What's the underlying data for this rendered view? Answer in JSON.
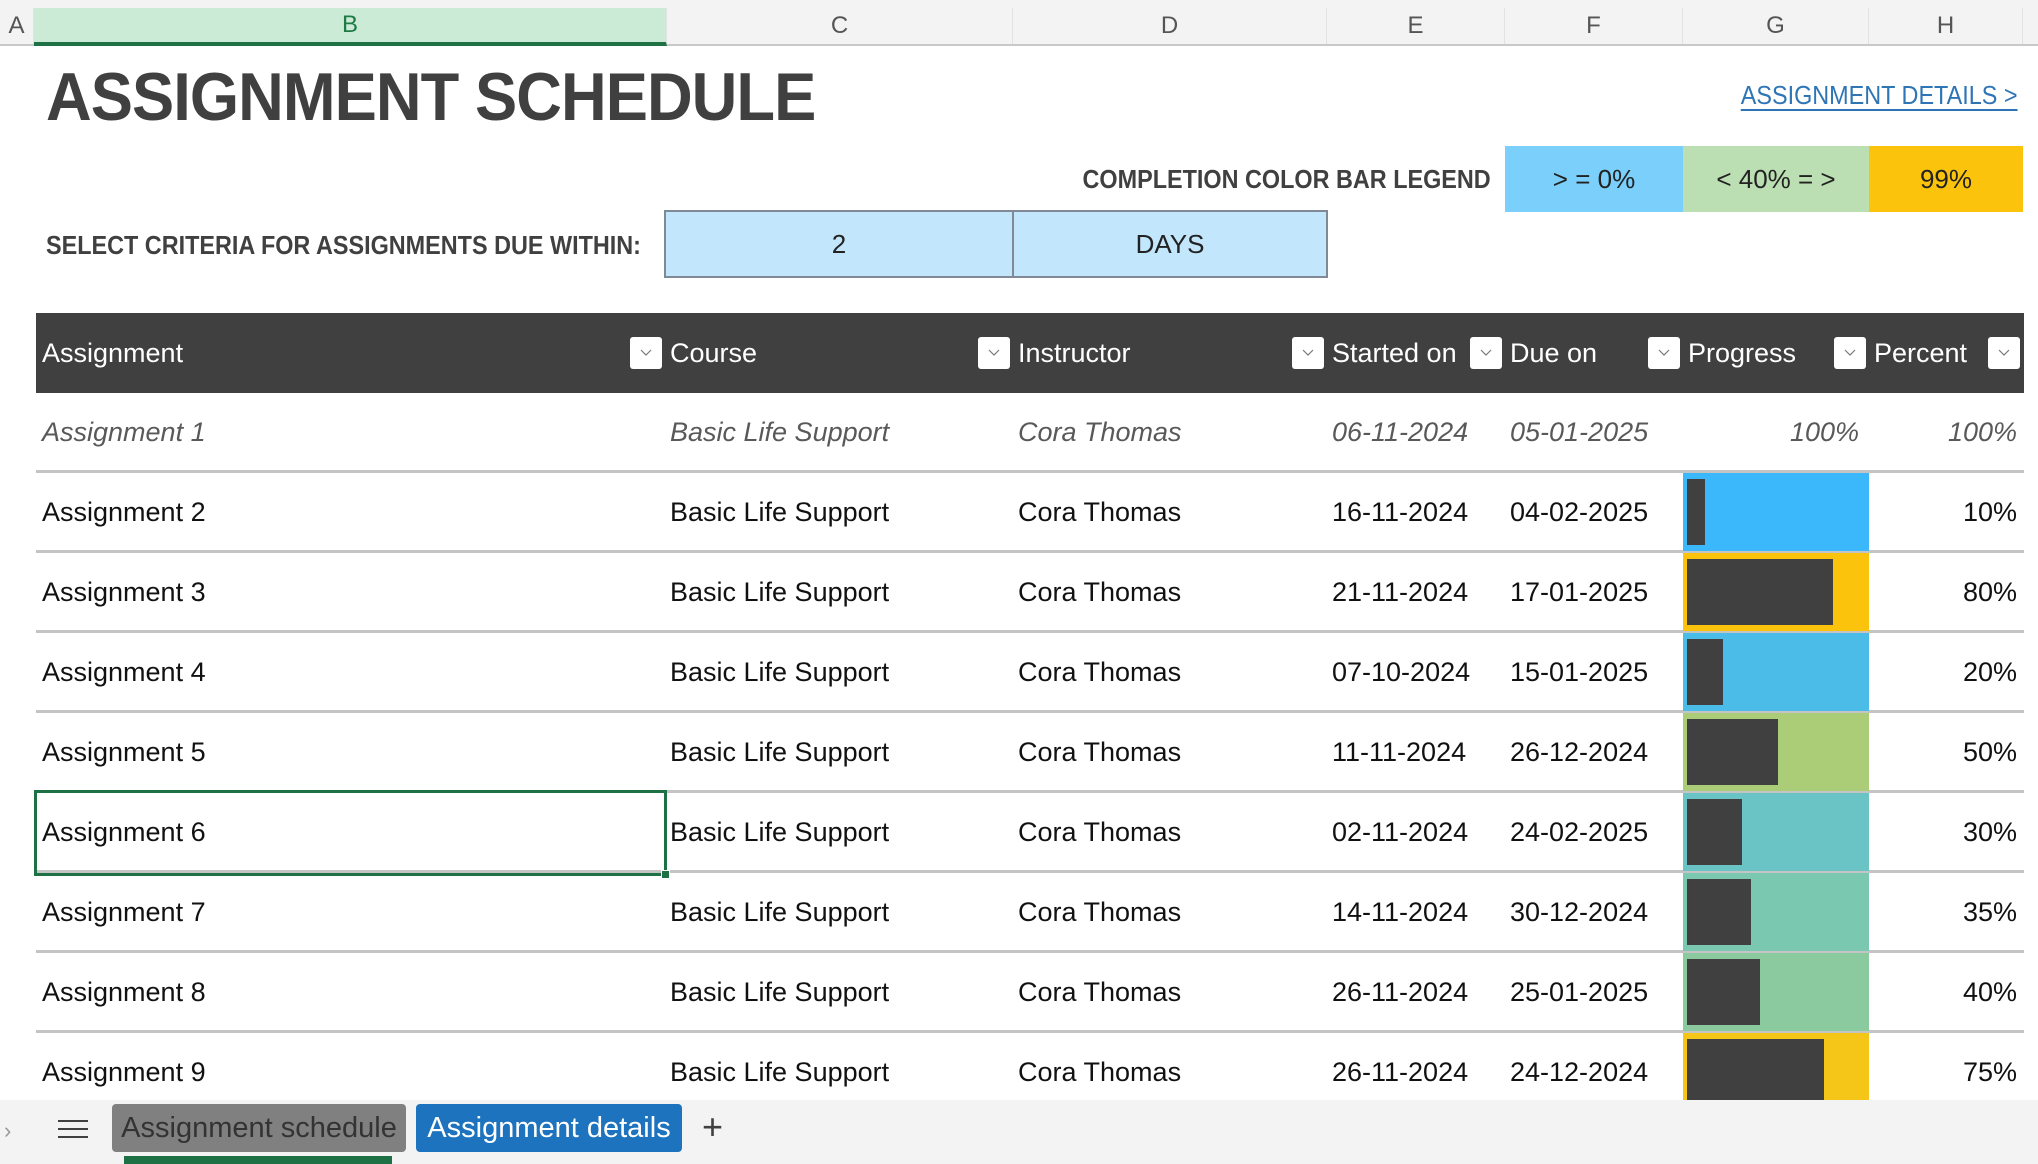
{
  "columns": [
    "A",
    "B",
    "C",
    "D",
    "E",
    "F",
    "G",
    "H"
  ],
  "selected_column": "B",
  "title": "ASSIGNMENT SCHEDULE",
  "details_link": "ASSIGNMENT DETAILS >",
  "legend": {
    "label": "COMPLETION COLOR BAR LEGEND",
    "items": [
      {
        "label": "> = 0%",
        "color": "#7acffb"
      },
      {
        "label": "< 40% = >",
        "color": "#bbdfb3"
      },
      {
        "label": "99%",
        "color": "#fcc30d"
      }
    ]
  },
  "criteria": {
    "label": "SELECT CRITERIA FOR ASSIGNMENTS DUE WITHIN:",
    "value": "2",
    "unit": "DAYS"
  },
  "table": {
    "headers": [
      "Assignment",
      "Course",
      "Instructor",
      "Started on",
      "Due on",
      "Progress",
      "Percent"
    ],
    "rows": [
      {
        "assignment": "Assignment 1",
        "course": "Basic Life Support",
        "instructor": "Cora Thomas",
        "started": "06-11-2024",
        "due": "05-01-2025",
        "progress_label": "100%",
        "percent": "100%",
        "progress": 1.0,
        "bar_color": null,
        "completed": true
      },
      {
        "assignment": "Assignment 2",
        "course": "Basic Life Support",
        "instructor": "Cora Thomas",
        "started": "16-11-2024",
        "due": "04-02-2025",
        "progress_label": "",
        "percent": "10%",
        "progress": 0.1,
        "bar_color": "#3bb7fb",
        "completed": false
      },
      {
        "assignment": "Assignment 3",
        "course": "Basic Life Support",
        "instructor": "Cora Thomas",
        "started": "21-11-2024",
        "due": "17-01-2025",
        "progress_label": "",
        "percent": "80%",
        "progress": 0.8,
        "bar_color": "#fcc30d",
        "completed": false
      },
      {
        "assignment": "Assignment 4",
        "course": "Basic Life Support",
        "instructor": "Cora Thomas",
        "started": "07-10-2024",
        "due": "15-01-2025",
        "progress_label": "",
        "percent": "20%",
        "progress": 0.2,
        "bar_color": "#4bbbe8",
        "completed": false
      },
      {
        "assignment": "Assignment 5",
        "course": "Basic Life Support",
        "instructor": "Cora Thomas",
        "started": "11-11-2024",
        "due": "26-12-2024",
        "progress_label": "",
        "percent": "50%",
        "progress": 0.5,
        "bar_color": "#abcd78",
        "completed": false
      },
      {
        "assignment": "Assignment 6",
        "course": "Basic Life Support",
        "instructor": "Cora Thomas",
        "started": "02-11-2024",
        "due": "24-02-2025",
        "progress_label": "",
        "percent": "30%",
        "progress": 0.3,
        "bar_color": "#6ac3c5",
        "completed": false
      },
      {
        "assignment": "Assignment 7",
        "course": "Basic Life Support",
        "instructor": "Cora Thomas",
        "started": "14-11-2024",
        "due": "30-12-2024",
        "progress_label": "",
        "percent": "35%",
        "progress": 0.35,
        "bar_color": "#7bc8b0",
        "completed": false
      },
      {
        "assignment": "Assignment 8",
        "course": "Basic Life Support",
        "instructor": "Cora Thomas",
        "started": "26-11-2024",
        "due": "25-01-2025",
        "progress_label": "",
        "percent": "40%",
        "progress": 0.4,
        "bar_color": "#8bca9e",
        "completed": false
      },
      {
        "assignment": "Assignment 9",
        "course": "Basic Life Support",
        "instructor": "Cora Thomas",
        "started": "26-11-2024",
        "due": "24-12-2024",
        "progress_label": "",
        "percent": "75%",
        "progress": 0.75,
        "bar_color": "#f5c518",
        "completed": false
      }
    ]
  },
  "selected_cell": "Assignment 6",
  "sheet_tabs": [
    {
      "label": "Assignment schedule",
      "active": true
    },
    {
      "label": "Assignment details",
      "active": false
    }
  ],
  "bar_fill_color": "#404040"
}
